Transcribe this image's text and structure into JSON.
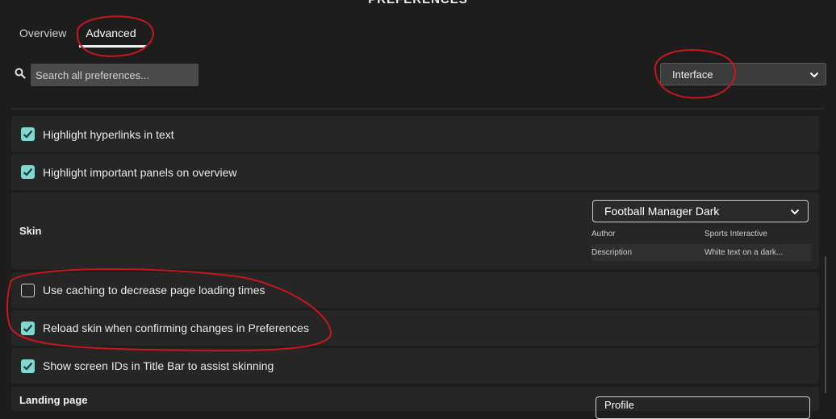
{
  "window": {
    "title": "PREFERENCES"
  },
  "tabs": [
    {
      "label": "Overview",
      "active": false
    },
    {
      "label": "Advanced",
      "active": true
    }
  ],
  "search": {
    "placeholder": "Search all preferences...",
    "icon": "search-icon"
  },
  "category_select": {
    "value": "Interface",
    "icon": "chevron-down-icon"
  },
  "options": [
    {
      "label": "Highlight hyperlinks in text",
      "checked": true
    },
    {
      "label": "Highlight important panels on overview",
      "checked": true
    },
    {
      "label": "Use caching to decrease page loading times",
      "checked": false
    },
    {
      "label": "Reload skin when confirming changes in Preferences",
      "checked": true
    },
    {
      "label": "Show screen IDs in Title Bar to assist skinning",
      "checked": true
    }
  ],
  "skin": {
    "label": "Skin",
    "selected": "Football Manager Dark",
    "info": [
      {
        "key": "Author",
        "value": "Sports Interactive"
      },
      {
        "key": "Description",
        "value": "White text on a dark..."
      }
    ]
  },
  "landing_page": {
    "label": "Landing page",
    "selected": "Profile"
  },
  "colors": {
    "background": "#1d1d1d",
    "row": "#262626",
    "checkbox_accent": "#7fd9d2",
    "annotation": "#c8161d"
  }
}
